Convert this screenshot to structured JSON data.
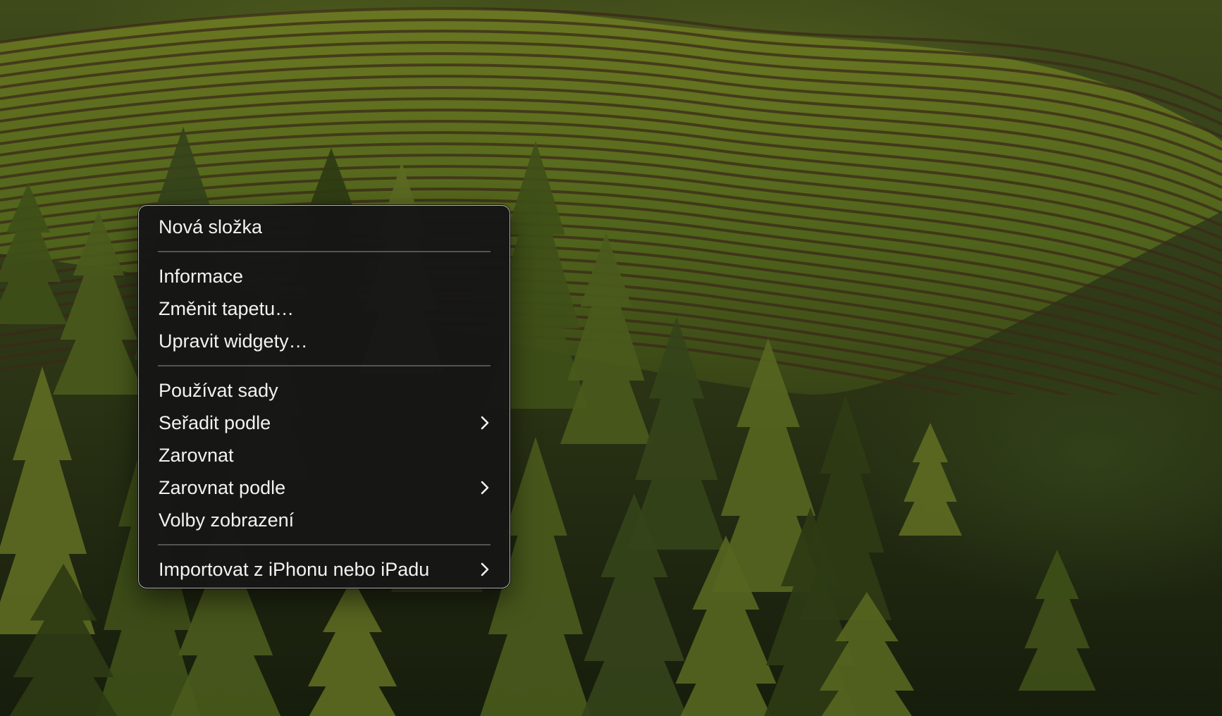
{
  "wallpaper": {
    "description_icon": "vineyard-hills-wallpaper"
  },
  "context_menu": {
    "groups": [
      [
        {
          "label": "Nová složka",
          "submenu": false
        }
      ],
      [
        {
          "label": "Informace",
          "submenu": false
        },
        {
          "label": "Změnit tapetu…",
          "submenu": false
        },
        {
          "label": "Upravit widgety…",
          "submenu": false
        }
      ],
      [
        {
          "label": "Používat sady",
          "submenu": false
        },
        {
          "label": "Seřadit podle",
          "submenu": true
        },
        {
          "label": "Zarovnat",
          "submenu": false
        },
        {
          "label": "Zarovnat podle",
          "submenu": true
        },
        {
          "label": "Volby zobrazení",
          "submenu": false
        }
      ],
      [
        {
          "label": "Importovat z iPhonu nebo iPadu",
          "submenu": true
        }
      ]
    ]
  },
  "colors": {
    "menu_background": "#161616",
    "menu_text": "#f2f2f2",
    "menu_border": "#cdcdcd"
  }
}
